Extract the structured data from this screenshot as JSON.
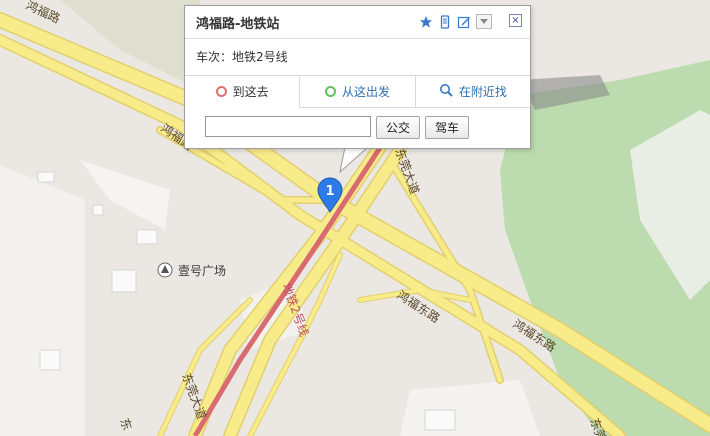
{
  "map": {
    "roads": {
      "honfu_top_left": "鸿福路",
      "honfu_mid_left": "鸿福路",
      "honfu_east_mid": "鸿福东路",
      "honfu_east_right": "鸿福东路",
      "dongguan_top": "东莞大道",
      "dongguan_bottom": "东莞大道",
      "dongguan_bottom_left": "东",
      "dongguan_bottom_right": "东莞",
      "metro_line": "地铁2号线"
    },
    "poi": {
      "label": "壹号广场"
    },
    "marker": {
      "number": "1",
      "color": "#2d7be8"
    },
    "colors": {
      "road": "#f8eb8a",
      "road_edge": "#e2cf6d",
      "park": "#bcdbae",
      "metro": "#d86a70",
      "land": "#ebe8e3"
    }
  },
  "popup": {
    "title": "鸿福路-地铁站",
    "line_info": "车次：地铁2号线",
    "tools": [
      "star-icon",
      "phone-icon",
      "edit-icon",
      "dropdown-icon"
    ],
    "close_symbol": "×",
    "tabs": [
      {
        "label": "到这去",
        "icon": "red-ring-icon"
      },
      {
        "label": "从这出发",
        "icon": "green-ring-icon"
      },
      {
        "label": "在附近找",
        "icon": "search-icon"
      }
    ],
    "input": {
      "value": "",
      "placeholder": ""
    },
    "buttons": {
      "bus": "公交",
      "drive": "驾车"
    }
  }
}
